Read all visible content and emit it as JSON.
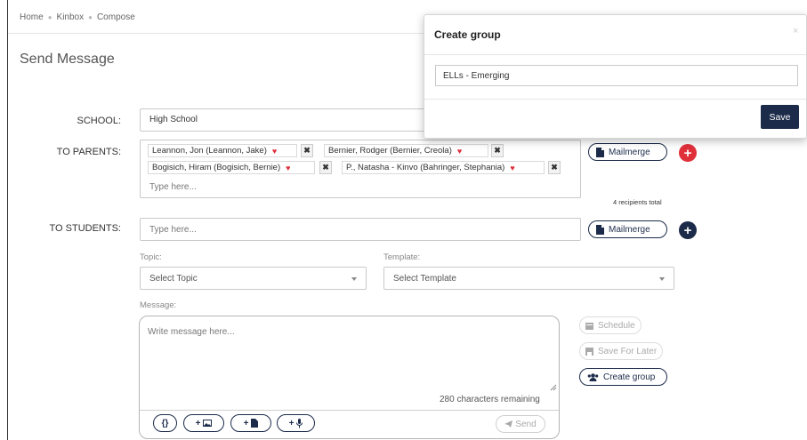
{
  "breadcrumb": [
    "Home",
    "Kinbox",
    "Compose"
  ],
  "page_title": "Send Message",
  "school": {
    "label": "SCHOOL:",
    "value": "High School"
  },
  "to_parents": {
    "label": "TO PARENTS:",
    "recipients": [
      "Leannon, Jon (Leannon, Jake)",
      "Bernier, Rodger (Bernier, Creola)",
      "Bogisich, Hiram (Bogisich, Bernie)",
      "P., Natasha - Kinvo (Bahringer, Stephania)"
    ],
    "placeholder": "Type here...",
    "mailmerge_label": "Mailmerge",
    "recipients_total": "4 recipients total"
  },
  "to_students": {
    "label": "TO STUDENTS:",
    "placeholder": "Type here...",
    "mailmerge_label": "Mailmerge"
  },
  "topic": {
    "label": "Topic:",
    "value": "Select Topic"
  },
  "template": {
    "label": "Template:",
    "value": "Select Template"
  },
  "message": {
    "label": "Message:",
    "placeholder": "Write message here...",
    "chars_remaining": "280 characters remaining",
    "toolbar": [
      "{}",
      "+",
      "+",
      "+"
    ],
    "send_label": "Send"
  },
  "side_actions": {
    "schedule": "Schedule",
    "save_for_later": "Save For Later",
    "create_group": "Create group"
  },
  "modal": {
    "title": "Create group",
    "close": "×",
    "input_value": "ELLs - Emerging",
    "save_label": "Save"
  },
  "colors": {
    "navy": "#1c2b4a",
    "red_add": "#e0303a",
    "heart": "#e0303a"
  },
  "icons": [
    "file-icon",
    "plus-icon",
    "calendar-icon",
    "save-icon",
    "users-icon",
    "image-icon",
    "mic-icon",
    "send-icon",
    "heart-icon",
    "remove-icon"
  ]
}
